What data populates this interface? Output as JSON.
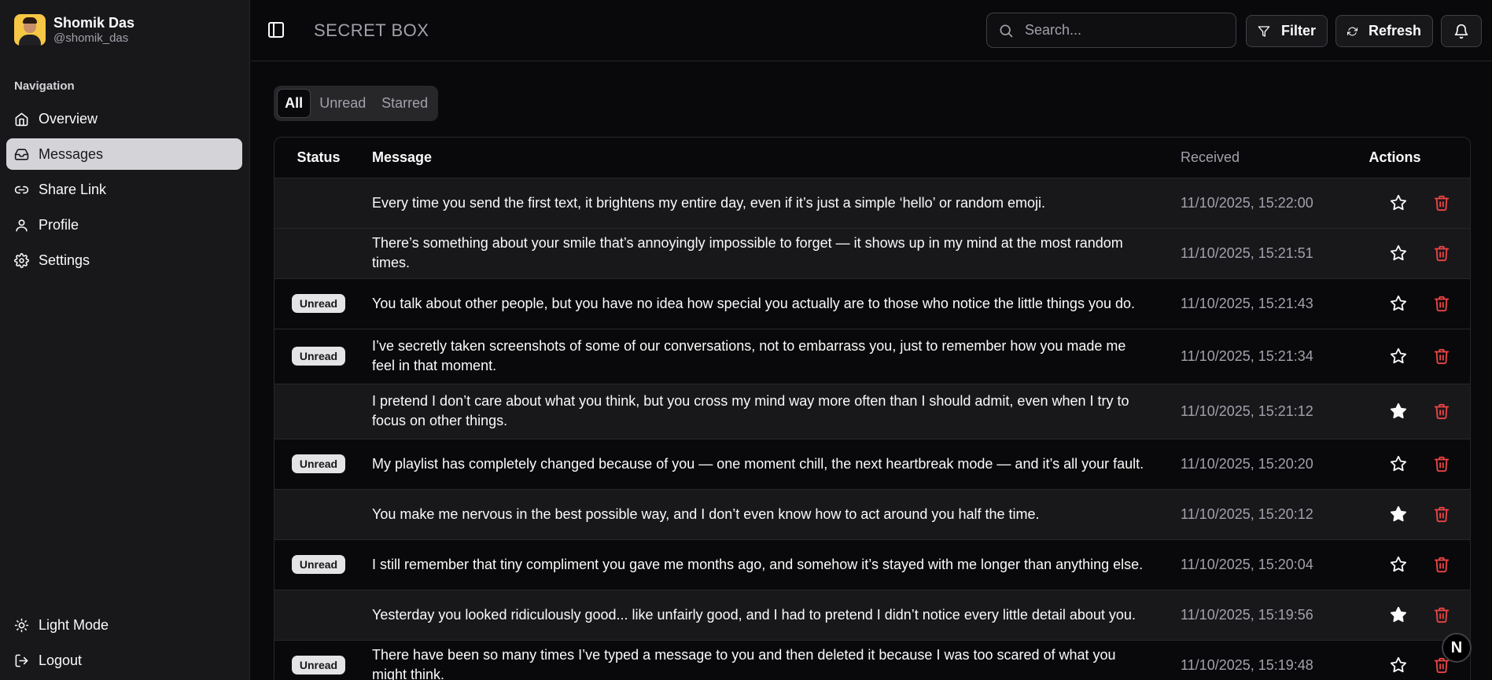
{
  "user": {
    "name": "Shomik Das",
    "handle": "@shomik_das"
  },
  "nav": {
    "title": "Navigation",
    "items": [
      {
        "label": "Overview",
        "icon": "home-icon"
      },
      {
        "label": "Messages",
        "icon": "inbox-icon",
        "active": true
      },
      {
        "label": "Share Link",
        "icon": "link-icon"
      },
      {
        "label": "Profile",
        "icon": "user-icon"
      },
      {
        "label": "Settings",
        "icon": "gear-icon"
      }
    ],
    "bottom": [
      {
        "label": "Light Mode",
        "icon": "sun-icon"
      },
      {
        "label": "Logout",
        "icon": "logout-icon"
      }
    ]
  },
  "header": {
    "title": "SECRET BOX",
    "search_placeholder": "Search...",
    "filter_label": "Filter",
    "refresh_label": "Refresh"
  },
  "tabs": [
    "All",
    "Unread",
    "Starred"
  ],
  "table": {
    "columns": [
      "Status",
      "Message",
      "Received",
      "Actions"
    ],
    "rows": [
      {
        "status": "",
        "message": "Every time you send the first text, it brightens my entire day, even if it’s just a simple ‘hello’ or random emoji.",
        "received": "11/10/2025, 15:22:00",
        "starred": false
      },
      {
        "status": "",
        "message": "There’s something about your smile that’s annoyingly impossible to forget — it shows up in my mind at the most random times.",
        "received": "11/10/2025, 15:21:51",
        "starred": false
      },
      {
        "status": "Unread",
        "message": "You talk about other people, but you have no idea how special you actually are to those who notice the little things you do.",
        "received": "11/10/2025, 15:21:43",
        "starred": false
      },
      {
        "status": "Unread",
        "message": "I’ve secretly taken screenshots of some of our conversations, not to embarrass you, just to remember how you made me feel in that moment.",
        "received": "11/10/2025, 15:21:34",
        "starred": false
      },
      {
        "status": "",
        "message": "I pretend I don’t care about what you think, but you cross my mind way more often than I should admit, even when I try to focus on other things.",
        "received": "11/10/2025, 15:21:12",
        "starred": true
      },
      {
        "status": "Unread",
        "message": "My playlist has completely changed because of you — one moment chill, the next heartbreak mode — and it’s all your fault.",
        "received": "11/10/2025, 15:20:20",
        "starred": false
      },
      {
        "status": "",
        "message": "You make me nervous in the best possible way, and I don’t even know how to act around you half the time.",
        "received": "11/10/2025, 15:20:12",
        "starred": true
      },
      {
        "status": "Unread",
        "message": "I still remember that tiny compliment you gave me months ago, and somehow it’s stayed with me longer than anything else.",
        "received": "11/10/2025, 15:20:04",
        "starred": false
      },
      {
        "status": "",
        "message": "Yesterday you looked ridiculously good... like unfairly good, and I had to pretend I didn’t notice every little detail about you.",
        "received": "11/10/2025, 15:19:56",
        "starred": true
      },
      {
        "status": "Unread",
        "message": "There have been so many times I’ve typed a message to you and then deleted it because I was too scared of what you might think.",
        "received": "11/10/2025, 15:19:48",
        "starred": false
      }
    ]
  },
  "fab_label": "N",
  "colors": {
    "background": "#09090b",
    "sidebar": "#18181b",
    "delete": "#ef4444",
    "active_nav": "#d4d4d8"
  }
}
